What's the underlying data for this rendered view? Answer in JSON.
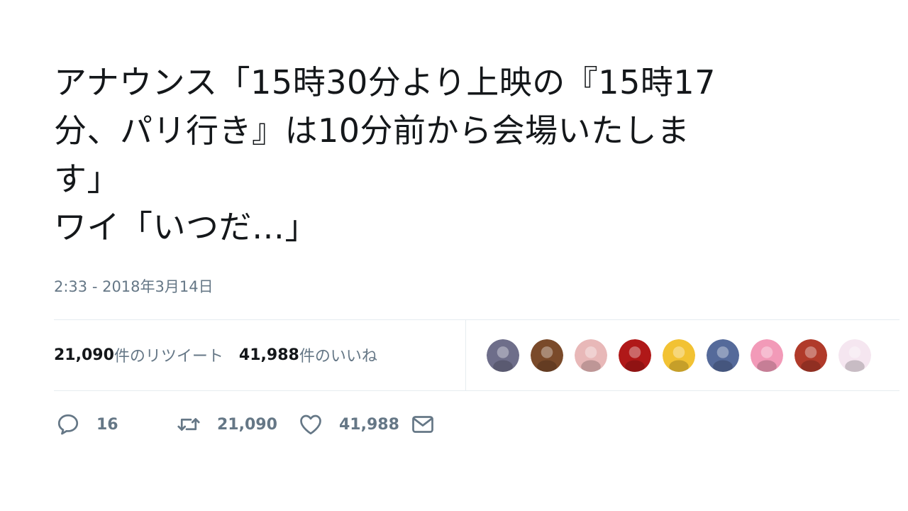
{
  "tweet": {
    "text_lines": [
      "アナウンス「15時30分より上映の『15時17",
      "分、パリ行き』は10分前から会場いたしま",
      "す」",
      "ワイ「いつだ…」"
    ],
    "timestamp": "2:33 - 2018年3月14日"
  },
  "stats": {
    "retweets_count": "21,090",
    "retweets_label": "件のリツイート",
    "likes_count": "41,988",
    "likes_label": "件のいいね"
  },
  "liker_avatars": [
    {
      "color": "#6e6e8a"
    },
    {
      "color": "#7a4a2a"
    },
    {
      "color": "#e8b8b8"
    },
    {
      "color": "#b01818"
    },
    {
      "color": "#f2c233"
    },
    {
      "color": "#556a9a"
    },
    {
      "color": "#f29ab8"
    },
    {
      "color": "#b03a2a"
    },
    {
      "color": "#f5e6f0"
    }
  ],
  "actions": {
    "reply_count": "16",
    "retweet_count": "21,090",
    "like_count": "41,988"
  },
  "colors": {
    "text": "#14171a",
    "secondary": "#657786",
    "divider": "#e6ecf0"
  }
}
